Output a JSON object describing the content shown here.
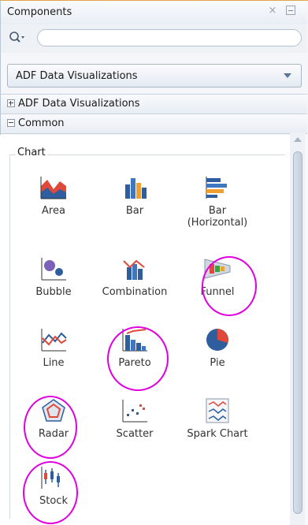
{
  "panel": {
    "title": "Components",
    "close_glyph": "×"
  },
  "search": {
    "placeholder": ""
  },
  "library_dropdown": {
    "selected": "ADF Data Visualizations"
  },
  "sections": [
    {
      "label": "ADF Data Visualizations",
      "expanded": false
    },
    {
      "label": "Common",
      "expanded": true
    }
  ],
  "group": {
    "label": "Chart"
  },
  "components": [
    {
      "label": "Area",
      "icon": "area-chart-icon"
    },
    {
      "label": "Bar",
      "icon": "bar-chart-icon"
    },
    {
      "label": "Bar\n(Horizontal)",
      "icon": "horizontal-bar-chart-icon"
    },
    {
      "label": "Bubble",
      "icon": "bubble-chart-icon"
    },
    {
      "label": "Combination",
      "icon": "combination-chart-icon"
    },
    {
      "label": "Funnel",
      "icon": "funnel-chart-icon"
    },
    {
      "label": "Line",
      "icon": "line-chart-icon"
    },
    {
      "label": "Pareto",
      "icon": "pareto-chart-icon"
    },
    {
      "label": "Pie",
      "icon": "pie-chart-icon"
    },
    {
      "label": "Radar",
      "icon": "radar-chart-icon"
    },
    {
      "label": "Scatter",
      "icon": "scatter-chart-icon"
    },
    {
      "label": "Spark Chart",
      "icon": "spark-chart-icon"
    },
    {
      "label": "Stock",
      "icon": "stock-chart-icon"
    }
  ],
  "highlighted": [
    "Funnel",
    "Pareto",
    "Radar",
    "Stock"
  ],
  "colors": {
    "highlight": "#e000e0",
    "accent_blue": "#2e5e9e"
  }
}
